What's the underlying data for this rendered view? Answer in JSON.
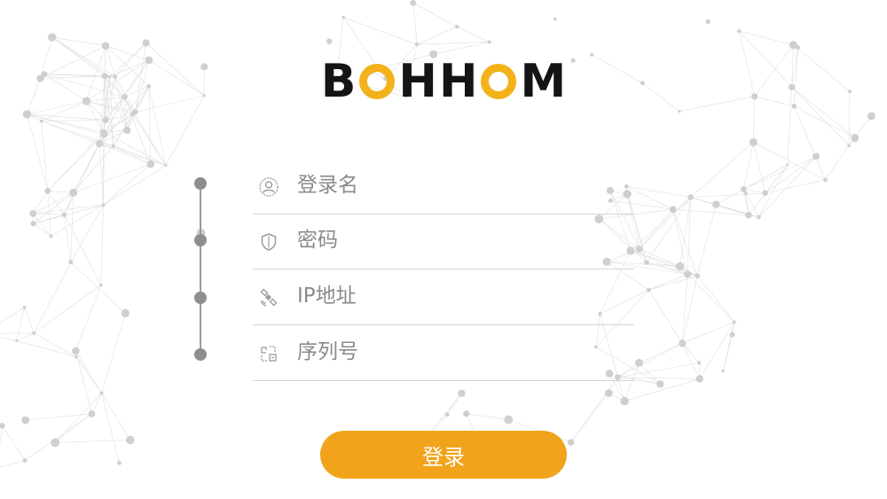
{
  "logo": {
    "letters": [
      "B",
      "O",
      "H",
      "H",
      "O",
      "M"
    ],
    "accent_color": "#f3b21a",
    "text_color": "#141414"
  },
  "form": {
    "fields": [
      {
        "name": "username",
        "icon": "user-icon",
        "placeholder": "登录名"
      },
      {
        "name": "password",
        "icon": "shield-icon",
        "placeholder": "密码"
      },
      {
        "name": "ip-address",
        "icon": "satellite-icon",
        "placeholder": "IP地址"
      },
      {
        "name": "serial-number",
        "icon": "serial-icon",
        "placeholder": "序列号"
      }
    ],
    "login_label": "登录",
    "button_color": "#f2a31c"
  }
}
